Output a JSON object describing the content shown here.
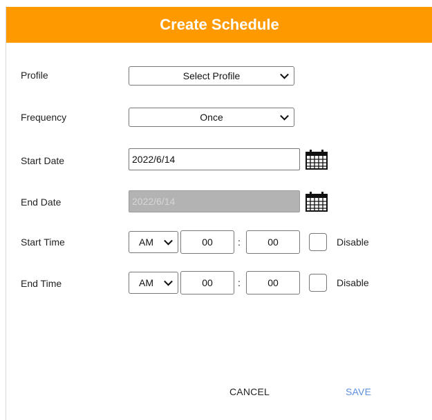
{
  "dialog": {
    "title": "Create Schedule"
  },
  "form": {
    "profile": {
      "label": "Profile",
      "value": "Select Profile"
    },
    "frequency": {
      "label": "Frequency",
      "value": "Once"
    },
    "start_date": {
      "label": "Start Date",
      "value": "2022/6/14",
      "icon": "calendar-icon"
    },
    "end_date": {
      "label": "End Date",
      "value": "2022/6/14",
      "disabled": true,
      "icon": "calendar-icon"
    },
    "start_time": {
      "label": "Start Time",
      "ampm": "AM",
      "hour": "00",
      "separator": ":",
      "minute": "00",
      "disable_label": "Disable",
      "disable_checked": false
    },
    "end_time": {
      "label": "End Time",
      "ampm": "AM",
      "hour": "00",
      "separator": ":",
      "minute": "00",
      "disable_label": "Disable",
      "disable_checked": false
    }
  },
  "actions": {
    "cancel_label": "CANCEL",
    "save_label": "SAVE"
  },
  "colors": {
    "header": "#ff9900",
    "save": "#5b8fe0",
    "disabled_field": "#b3b3b3"
  }
}
